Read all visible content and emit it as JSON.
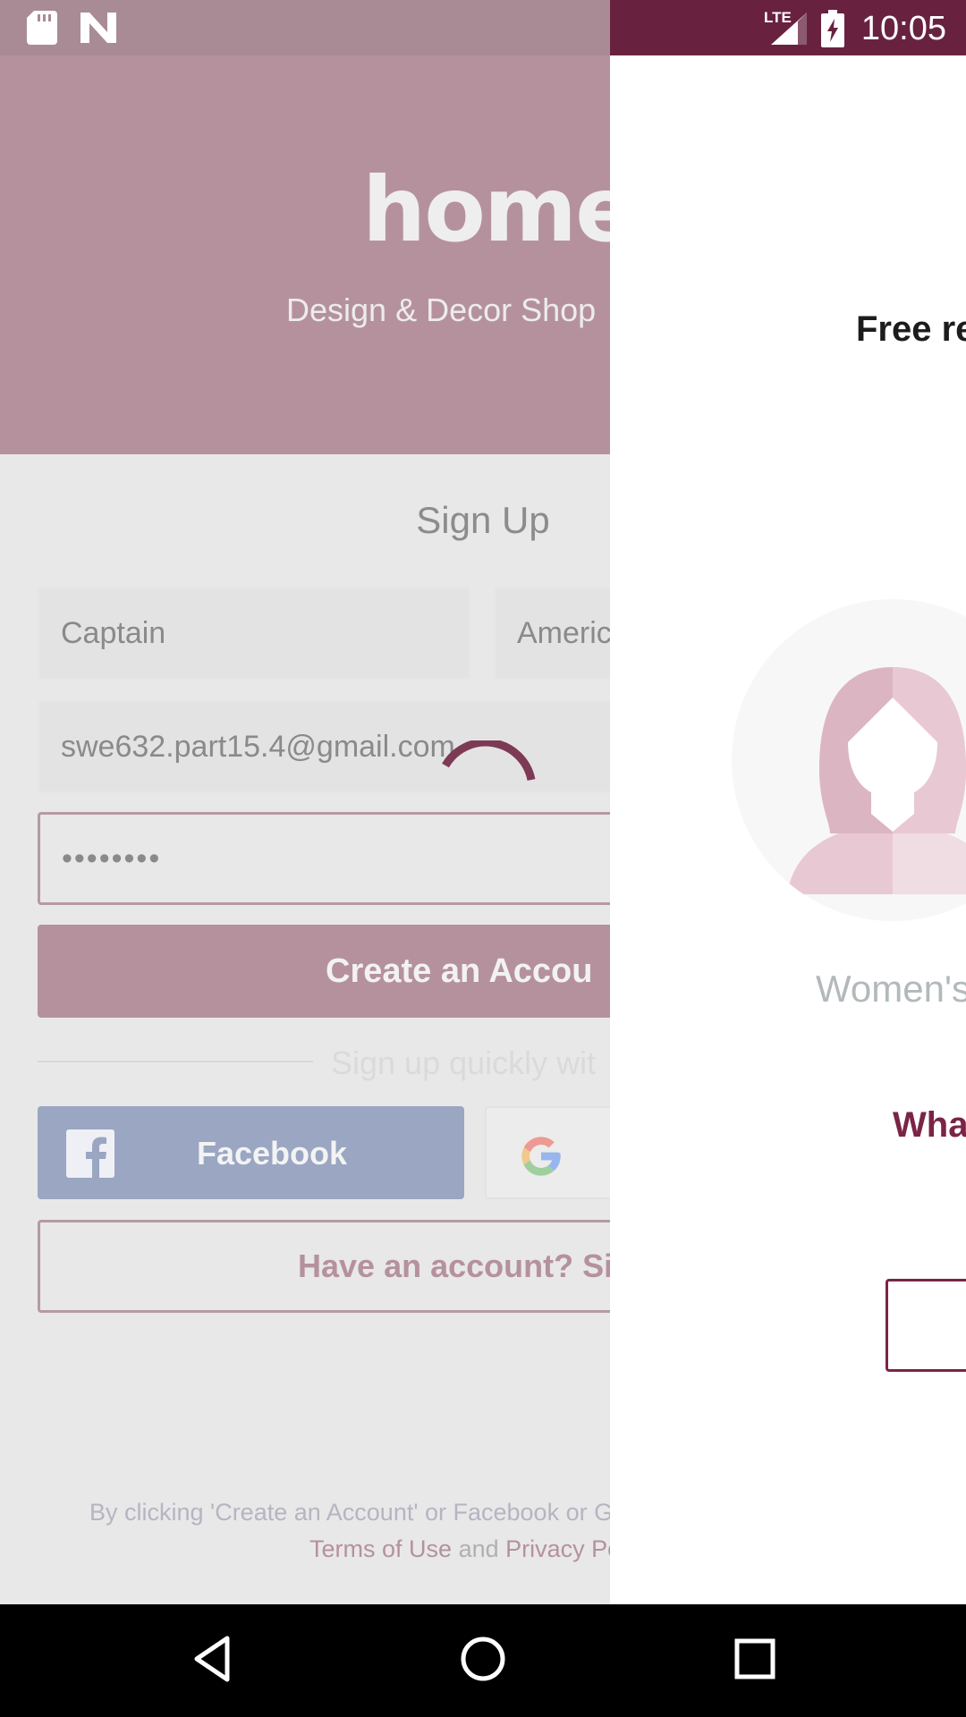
{
  "status_bar": {
    "time": "10:05",
    "network": "LTE",
    "icons": [
      "sd-card-icon",
      "n-logo-icon",
      "lte-signal-icon",
      "battery-charging-icon"
    ]
  },
  "brand": {
    "logo": "home",
    "tagline": "Design & Decor Shop"
  },
  "signup": {
    "title": "Sign Up",
    "first_name": "Captain",
    "last_name": "Americ",
    "email": "swe632.part15.4@gmail.com",
    "password_mask": "••••••••",
    "create_button": "Create an Accou",
    "divider_text": "Sign up quickly wit",
    "facebook_button": "Facebook",
    "google_icon": "google-icon",
    "have_account_button": "Have an account? Sig",
    "terms_line1": "By clicking 'Create an Account' or Facebook or G",
    "terms_link1": "Terms of Use",
    "terms_and": "and",
    "terms_link2": "Privacy Po"
  },
  "right_panel": {
    "free_text": "Free re",
    "avatar_icon": "woman-avatar-icon",
    "category_label": "Women's",
    "question": "Wha"
  },
  "navbar": {
    "icons": [
      "back-icon",
      "home-icon",
      "recents-icon"
    ]
  },
  "colors": {
    "brand": "#68223f",
    "accent": "#7a2446",
    "hero_dimmed": "#b5919e",
    "facebook_dimmed": "#9aa6c2"
  }
}
